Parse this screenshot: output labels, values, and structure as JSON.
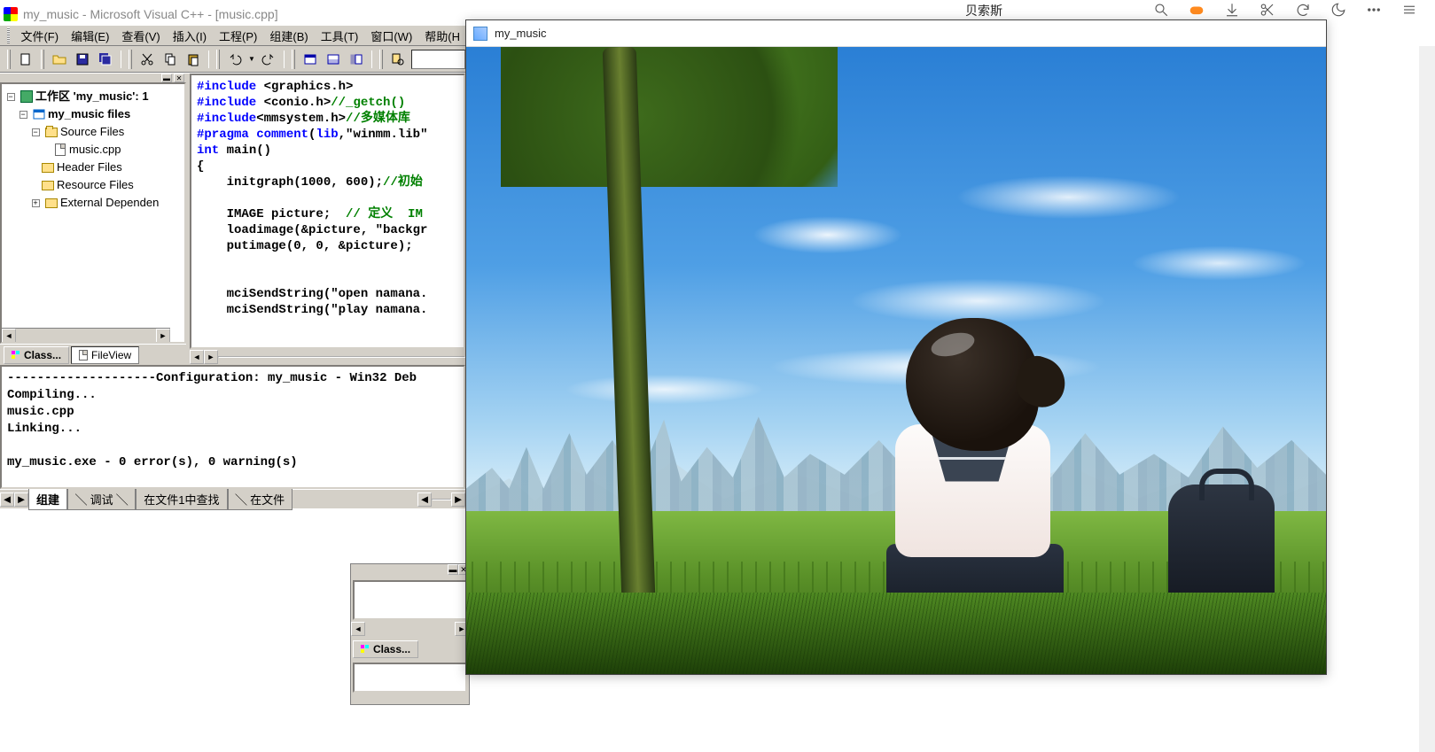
{
  "sysbar": {
    "text": "贝索斯"
  },
  "vc": {
    "title": "my_music - Microsoft Visual C++ - [music.cpp]",
    "menu": {
      "file": "文件(F)",
      "edit": "编辑(E)",
      "view": "查看(V)",
      "insert": "插入(I)",
      "project": "工程(P)",
      "build": "组建(B)",
      "tools": "工具(T)",
      "window": "窗口(W)",
      "help": "帮助(H"
    },
    "tree": {
      "workspace": "工作区 'my_music': 1",
      "project": "my_music files",
      "source_folder": "Source Files",
      "source_file": "music.cpp",
      "header_folder": "Header Files",
      "resource_folder": "Resource Files",
      "external": "External Dependen"
    },
    "tree_tabs": {
      "class": "Class...",
      "file": "FileView"
    },
    "code": {
      "l1a": "#include ",
      "l1b": "<graphics.h>",
      "l2a": "#include ",
      "l2b": "<conio.h>",
      "l2c": "//_getch()",
      "l3a": "#include",
      "l3b": "<mmsystem.h>",
      "l3c": "//多媒体库",
      "l4a": "#pragma ",
      "l4b": "comment",
      "l4c": "(",
      "l4d": "lib",
      "l4e": ",\"winmm.lib\"",
      "l5a": "int",
      "l5b": " main()",
      "l6": "{",
      "l7a": "    initgraph(1000, 600);",
      "l7b": "//初始",
      "l8": "",
      "l9a": "    IMAGE picture;  ",
      "l9b": "// 定义  IM",
      "l10": "    loadimage(&picture, \"backgr",
      "l11": "    putimage(0, 0, &picture);",
      "l12": "",
      "l13": "",
      "l14": "    mciSendString(\"open namana.",
      "l15": "    mciSendString(\"play namana."
    },
    "output": {
      "l0": "--------------------Configuration: my_music - Win32 Deb",
      "l1": "Compiling...",
      "l2": "music.cpp",
      "l3": "Linking...",
      "l4": "",
      "l5": "my_music.exe - 0 error(s), 0 warning(s)"
    },
    "otabs": {
      "build": "组建",
      "debug": "调试",
      "find1": "在文件1中查找",
      "find2": "在文件"
    },
    "float_tab": "Class..."
  },
  "app": {
    "title": "my_music"
  }
}
